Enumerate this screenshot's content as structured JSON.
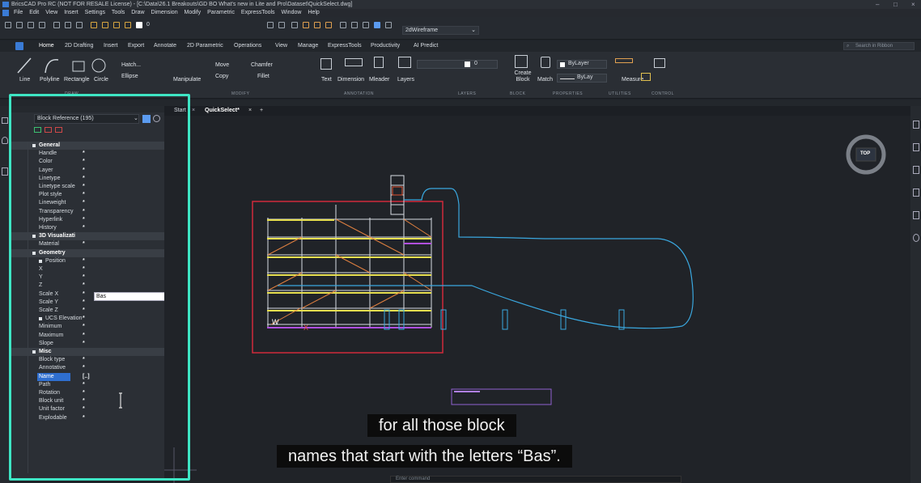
{
  "app": {
    "title": "BricsCAD Pro RC (NOT FOR RESALE License) - [C:\\Data\\26.1 Breakouts\\GD BO What's new in Lite and Pro\\Dataset\\QuickSelect.dwg]",
    "window_controls": [
      "–",
      "□",
      "×"
    ]
  },
  "menu": [
    "File",
    "Edit",
    "View",
    "Insert",
    "Settings",
    "Tools",
    "Draw",
    "Dimension",
    "Modify",
    "Parametric",
    "ExpressTools",
    "Window",
    "Help"
  ],
  "quick_access": {
    "layer_value": "0",
    "visual_style": "2dWireframe"
  },
  "ribbon_tabs": [
    "Home",
    "2D Drafting",
    "Insert",
    "Export",
    "Annotate",
    "2D Parametric",
    "Operations",
    "View",
    "Manage",
    "ExpressTools",
    "Productivity",
    "AI Predict"
  ],
  "active_tab": "Home",
  "search_placeholder": "Search in Ribbon",
  "ribbon": {
    "draw": [
      "Line",
      "Polyline",
      "Rectangle",
      "Circle"
    ],
    "hatch": "Hatch...",
    "ellipse": "Ellipse",
    "manipulate": "Manipulate",
    "move": "Move",
    "copy": "Copy",
    "chamfer": "Chamfer",
    "fillet": "Fillet",
    "text": "Text",
    "dimension": "Dimension",
    "mleader": "Mleader",
    "layers": "Layers",
    "layer_value": "0",
    "create_block": "Create Block",
    "match": "Match",
    "bylayer1": "ByLayer",
    "bylayer2": "ByLay",
    "measure": "Measure",
    "groups": [
      "DRAW",
      "MODIFY",
      "ANNOTATION",
      "LAYERS",
      "BLOCK",
      "PROPERTIES",
      "UTILITIES",
      "CONTROL"
    ]
  },
  "properties": {
    "selection": "Block Reference (195)",
    "rows": [
      {
        "label": "General",
        "kind": "section"
      },
      {
        "label": "Handle",
        "kind": "prop"
      },
      {
        "label": "Color",
        "kind": "prop"
      },
      {
        "label": "Layer",
        "kind": "prop"
      },
      {
        "label": "Linetype",
        "kind": "prop"
      },
      {
        "label": "Linetype scale",
        "kind": "prop"
      },
      {
        "label": "Plot style",
        "kind": "prop"
      },
      {
        "label": "Lineweight",
        "kind": "prop"
      },
      {
        "label": "Transparency",
        "kind": "prop"
      },
      {
        "label": "Hyperlink",
        "kind": "prop"
      },
      {
        "label": "History",
        "kind": "prop"
      },
      {
        "label": "3D Visualizati",
        "kind": "section"
      },
      {
        "label": "Material",
        "kind": "prop"
      },
      {
        "label": "Geometry",
        "kind": "section"
      },
      {
        "label": "Position",
        "kind": "sub"
      },
      {
        "label": "X",
        "kind": "prop"
      },
      {
        "label": "Y",
        "kind": "prop"
      },
      {
        "label": "Z",
        "kind": "prop"
      },
      {
        "label": "Scale X",
        "kind": "prop"
      },
      {
        "label": "Scale Y",
        "kind": "prop"
      },
      {
        "label": "Scale Z",
        "kind": "prop"
      },
      {
        "label": "UCS Elevation",
        "kind": "sub"
      },
      {
        "label": "Minimum",
        "kind": "prop"
      },
      {
        "label": "Maximum",
        "kind": "prop"
      },
      {
        "label": "Slope",
        "kind": "prop"
      },
      {
        "label": "Misc",
        "kind": "section"
      },
      {
        "label": "Block type",
        "kind": "prop"
      },
      {
        "label": "Annotative",
        "kind": "prop"
      },
      {
        "label": "Name",
        "kind": "selected"
      },
      {
        "label": "Path",
        "kind": "prop"
      },
      {
        "label": "Rotation",
        "kind": "prop"
      },
      {
        "label": "Block unit",
        "kind": "prop"
      },
      {
        "label": "Unit factor",
        "kind": "prop"
      },
      {
        "label": "Explodable",
        "kind": "prop"
      }
    ],
    "star": "*",
    "name_prefix": "[..]",
    "name_input": "Bas"
  },
  "drawing_tabs": [
    "Start",
    "QuickSelect*"
  ],
  "viewcube": "TOP",
  "command_placeholder": "Enter command",
  "subtitles": [
    "for all those block",
    "names that start with the letters “Bas”."
  ],
  "colors": {
    "highlight": "#3ee5c4",
    "accent": "#2f6fd0"
  }
}
